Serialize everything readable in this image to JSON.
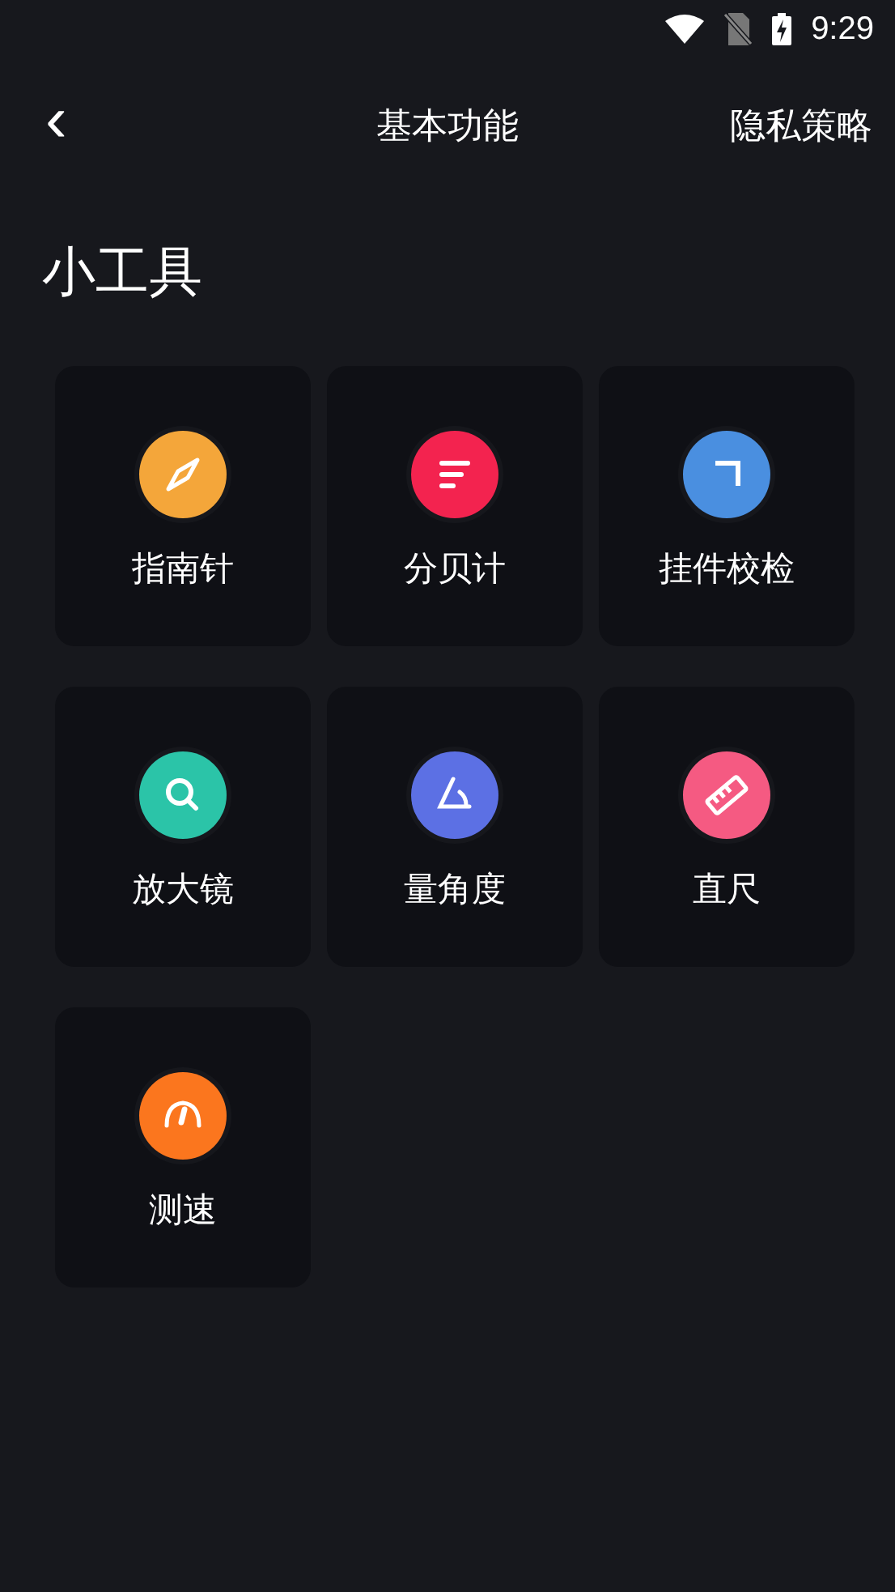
{
  "status_bar": {
    "time": "9:29"
  },
  "header": {
    "back": "‹",
    "title": "基本功能",
    "action": "隐私策略"
  },
  "section": {
    "title": "小工具"
  },
  "tools": [
    {
      "label": "指南针",
      "kind": "compass",
      "color": "#f4a63a"
    },
    {
      "label": "分贝计",
      "kind": "decibel",
      "color": "#f3234f"
    },
    {
      "label": "挂件校检",
      "kind": "corner",
      "color": "#4a8fe0"
    },
    {
      "label": "放大镜",
      "kind": "magnifier",
      "color": "#2bc4a8"
    },
    {
      "label": "量角度",
      "kind": "angle",
      "color": "#5c70e4"
    },
    {
      "label": "直尺",
      "kind": "ruler",
      "color": "#f55a82"
    },
    {
      "label": "测速",
      "kind": "speed",
      "color": "#fb761e"
    }
  ]
}
